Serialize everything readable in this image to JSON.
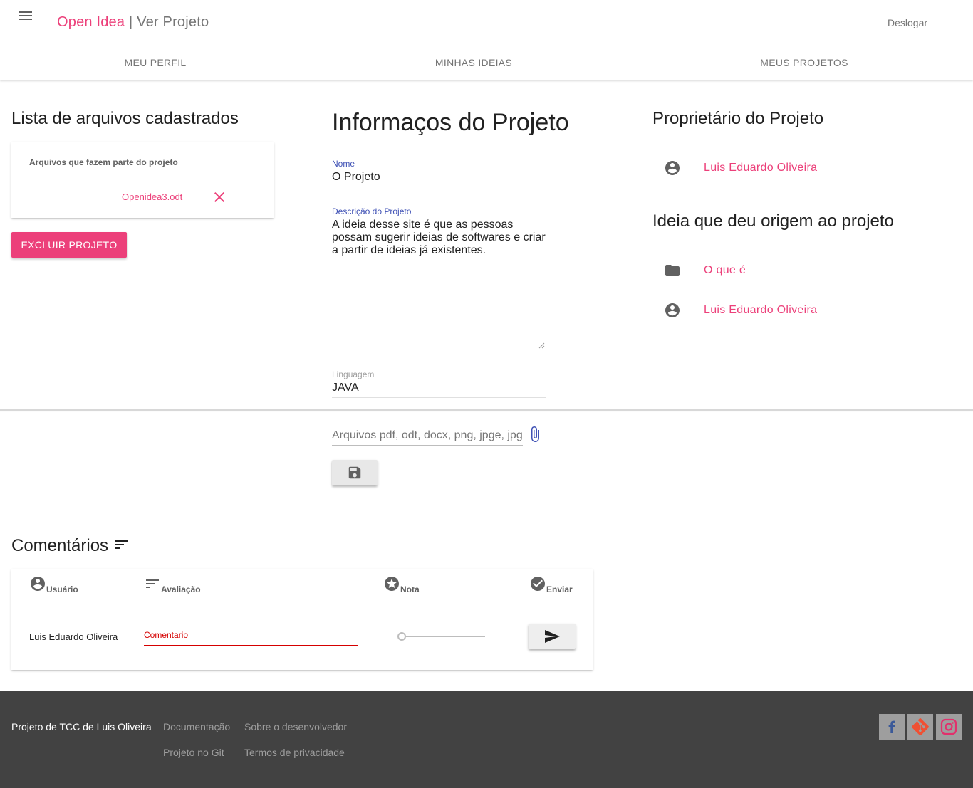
{
  "header": {
    "brand": "Open Idea",
    "separator": "|",
    "page_title": "Ver Projeto",
    "logout": "Deslogar",
    "tabs": [
      {
        "label": "MEU PERFIL"
      },
      {
        "label": "MINHAS IDEIAS"
      },
      {
        "label": "MEUS PROJETOS"
      }
    ]
  },
  "files": {
    "title": "Lista de arquivos cadastrados",
    "column_header": "Arquivos que fazem parte do projeto",
    "items": [
      {
        "name": "Openidea3.odt"
      }
    ],
    "delete_button": "EXCLUIR PROJETO"
  },
  "project": {
    "title": "Informaços do Projeto",
    "name_label": "Nome",
    "name_value": "O Projeto",
    "description_label": "Descrição do Projeto",
    "description_value": "A ideia desse site é que as pessoas possam sugerir ideias de softwares e criar a partir de ideias já existentes.",
    "language_label": "Linguagem",
    "language_value": "JAVA",
    "upload_placeholder": "Arquivos pdf, odt, docx, png, jpge, jpg"
  },
  "owner": {
    "title": "Proprietário do Projeto",
    "name": "Luis Eduardo Oliveira"
  },
  "origin": {
    "title": "Ideia que deu origem ao projeto",
    "idea": "O que é",
    "author": "Luis Eduardo Oliveira"
  },
  "comments": {
    "title": "Comentários",
    "columns": {
      "user": "Usuário",
      "rating": "Avaliação",
      "score": "Nota",
      "send": "Enviar"
    },
    "row": {
      "user": "Luis Eduardo Oliveira",
      "comment_placeholder": "Comentario",
      "score": 0
    }
  },
  "footer": {
    "credit": "Projeto de TCC de Luis Oliveira",
    "links": [
      "Documentação",
      "Sobre o desenvolvedor",
      "Projeto no Git",
      "Termos de privacidade"
    ],
    "social": [
      "facebook-icon",
      "git-icon",
      "instagram-icon"
    ]
  },
  "colors": {
    "accent": "#ec407a",
    "label_blue": "#3f51b5",
    "error_red": "#d50000",
    "footer_bg": "#424242"
  }
}
